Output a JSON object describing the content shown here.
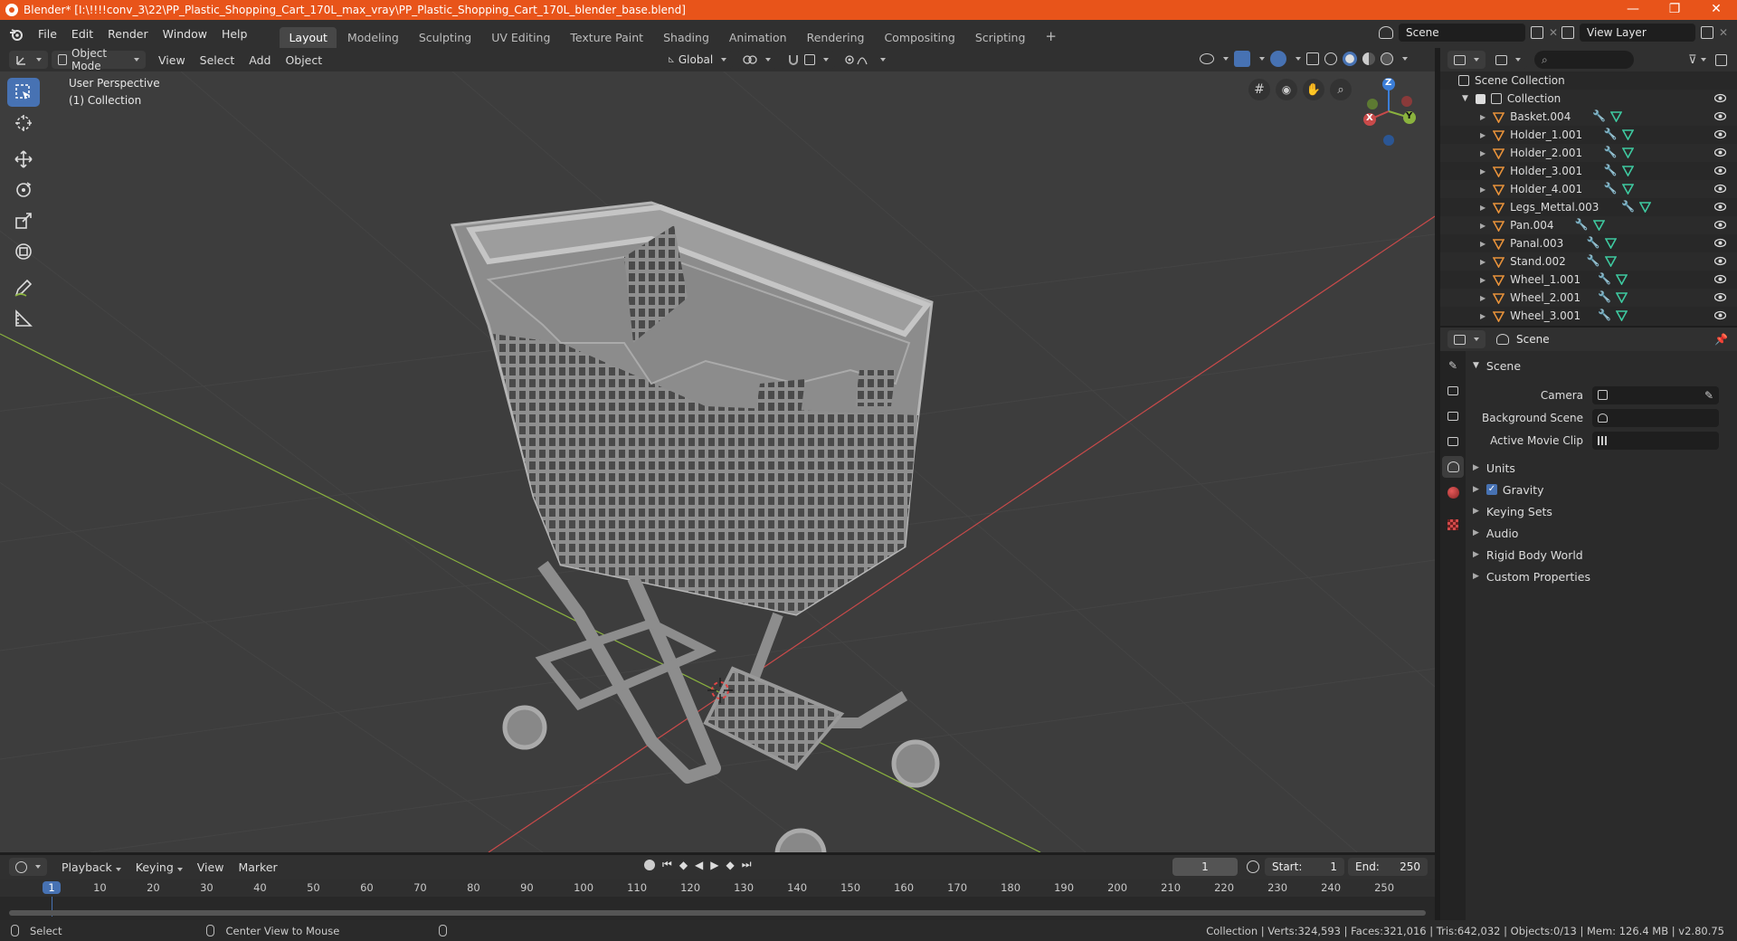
{
  "window": {
    "title": "Blender* [I:\\!!!!conv_3\\22\\PP_Plastic_Shopping_Cart_170L_max_vray\\PP_Plastic_Shopping_Cart_170L_blender_base.blend]",
    "controls": [
      "—",
      "❐",
      "✕"
    ]
  },
  "menu": {
    "items": [
      "File",
      "Edit",
      "Render",
      "Window",
      "Help"
    ],
    "workspaces": [
      "Layout",
      "Modeling",
      "Sculpting",
      "UV Editing",
      "Texture Paint",
      "Shading",
      "Animation",
      "Rendering",
      "Compositing",
      "Scripting"
    ],
    "active_workspace": "Layout",
    "add_tab": "+",
    "scene": "Scene",
    "view_layer": "View Layer"
  },
  "viewport_header": {
    "mode": "Object Mode",
    "menus": [
      "View",
      "Select",
      "Add",
      "Object"
    ],
    "orientation": "Global"
  },
  "viewport": {
    "perspective": "User Perspective",
    "collection": "(1) Collection",
    "gizmo": {
      "z": "Z",
      "y": "Y",
      "x": "X"
    }
  },
  "outliner": {
    "root": "Scene Collection",
    "collection": "Collection",
    "objects": [
      "Basket.004",
      "Holder_1.001",
      "Holder_2.001",
      "Holder_3.001",
      "Holder_4.001",
      "Legs_Mettal.003",
      "Pan.004",
      "Panal.003",
      "Stand.002",
      "Wheel_1.001",
      "Wheel_2.001",
      "Wheel_3.001"
    ]
  },
  "properties": {
    "context": "Scene",
    "panel": "Scene",
    "fields": {
      "camera": "Camera",
      "background_scene": "Background Scene",
      "active_movie_clip": "Active Movie Clip"
    },
    "sections": [
      "Units",
      "Gravity",
      "Keying Sets",
      "Audio",
      "Rigid Body World",
      "Custom Properties"
    ]
  },
  "timeline": {
    "menus": [
      "Playback",
      "Keying",
      "View",
      "Marker"
    ],
    "current_frame": "1",
    "start_label": "Start:",
    "start": "1",
    "end_label": "End:",
    "end": "250",
    "ticks": [
      "1",
      "10",
      "20",
      "30",
      "40",
      "50",
      "60",
      "70",
      "80",
      "90",
      "100",
      "110",
      "120",
      "130",
      "140",
      "150",
      "160",
      "170",
      "180",
      "190",
      "200",
      "210",
      "220",
      "230",
      "240",
      "250"
    ]
  },
  "status": {
    "select": "Select",
    "center_view": "Center View to Mouse",
    "stats": "Collection | Verts:324,593 | Faces:321,016 | Tris:642,032 | Objects:0/13 | Mem: 126.4 MB | v2.80.75"
  },
  "colors": {
    "titlebar": "#e8541a",
    "accent": "#4772b3",
    "x_axis": "#c94a4a",
    "y_axis": "#8ab23e"
  }
}
